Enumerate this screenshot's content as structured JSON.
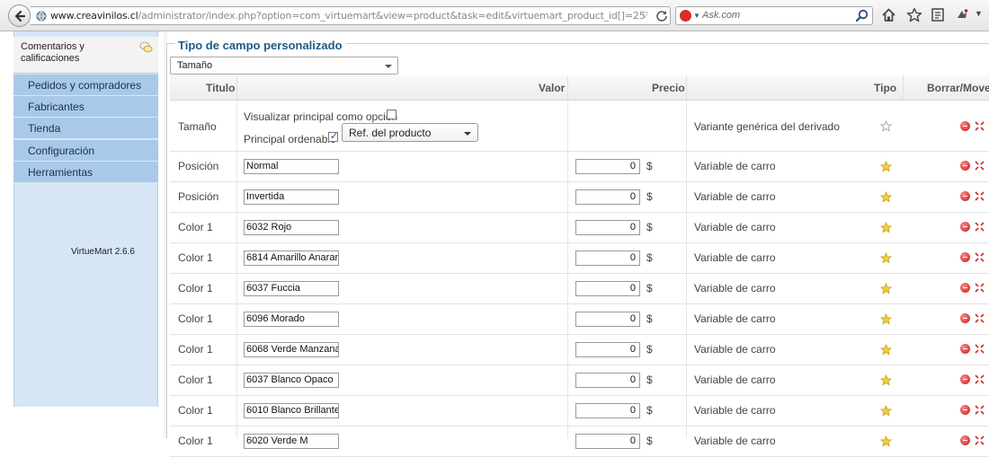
{
  "browser": {
    "url_domain": "www.creavinilos.cl",
    "url_path": "/administrator/index.php?option=com_virtuemart&view=product&task=edit&virtuemart_product_id[]=25",
    "search_placeholder": "Ask.com"
  },
  "sidebar": {
    "header_line1": "Comentarios y",
    "header_line2": "calificaciones",
    "items": [
      {
        "label": "Pedidos y compradores"
      },
      {
        "label": "Fabricantes"
      },
      {
        "label": "Tienda"
      },
      {
        "label": "Configuración"
      },
      {
        "label": "Herramientas"
      }
    ],
    "version": "VirtueMart 2.6.6"
  },
  "main": {
    "legend": "Tipo de campo personalizado",
    "type_select": "Tamaño",
    "columns": {
      "title": "Titulo",
      "value": "Valor",
      "price": "Precio",
      "type": "Tipo",
      "actions": "Borrar/Mover"
    },
    "first_row": {
      "title": "Tamaño",
      "display_main_label": "Visualizar principal como opción",
      "display_main_checked": false,
      "sortable_label": "Principal ordenable",
      "sortable_checked": true,
      "sort_select": "Ref. del producto",
      "type": "Variante genérica del derivado"
    },
    "rows": [
      {
        "title": "Posición",
        "value": "Normal",
        "price": "0",
        "currency": "$",
        "type": "Variable de carro"
      },
      {
        "title": "Posición",
        "value": "Invertida",
        "price": "0",
        "currency": "$",
        "type": "Variable de carro"
      },
      {
        "title": "Color 1",
        "value": "6032 Rojo",
        "price": "0",
        "currency": "$",
        "type": "Variable de carro"
      },
      {
        "title": "Color 1",
        "value": "6814 Amarillo Anaranj",
        "price": "0",
        "currency": "$",
        "type": "Variable de carro"
      },
      {
        "title": "Color 1",
        "value": "6037 Fuccia",
        "price": "0",
        "currency": "$",
        "type": "Variable de carro"
      },
      {
        "title": "Color 1",
        "value": "6096 Morado",
        "price": "0",
        "currency": "$",
        "type": "Variable de carro"
      },
      {
        "title": "Color 1",
        "value": "6068 Verde Manzana",
        "price": "0",
        "currency": "$",
        "type": "Variable de carro"
      },
      {
        "title": "Color 1",
        "value": "6037 Blanco Opaco",
        "price": "0",
        "currency": "$",
        "type": "Variable de carro"
      },
      {
        "title": "Color 1",
        "value": "6010 Blanco Brillante",
        "price": "0",
        "currency": "$",
        "type": "Variable de carro"
      },
      {
        "title": "Color 1",
        "value": "6020 Verde M",
        "price": "0",
        "currency": "$",
        "type": "Variable de carro"
      }
    ]
  }
}
